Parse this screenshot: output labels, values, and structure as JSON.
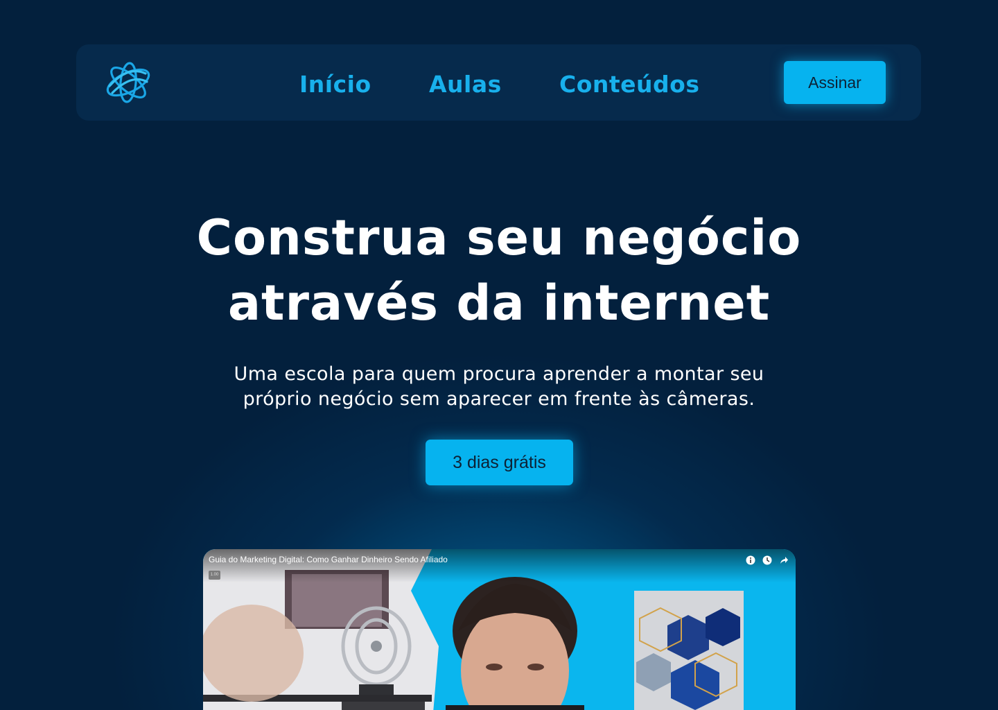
{
  "nav": {
    "logo": "triple-ring-logo-icon",
    "links": [
      "Início",
      "Aulas",
      "Conteúdos"
    ],
    "cta": "Assinar"
  },
  "hero": {
    "title_line1": "Construa seu negócio",
    "title_line2": "através da internet",
    "subtitle_line1": "Uma escola para quem procura aprender a montar seu",
    "subtitle_line2": "próprio negócio sem aparecer em frente às câmeras.",
    "cta": "3 dias grátis"
  },
  "video": {
    "title": "Guia do Marketing Digital: Como Ganhar Dinheiro Sendo Afiliado",
    "speed": "1.00",
    "icons": [
      "info-icon",
      "watch-later-icon",
      "share-icon"
    ]
  },
  "colors": {
    "background": "#03203d",
    "navbar": "#062a4c",
    "accent": "#06b3ef",
    "nav_text": "#18b0ec",
    "button_text": "#0d2135"
  }
}
